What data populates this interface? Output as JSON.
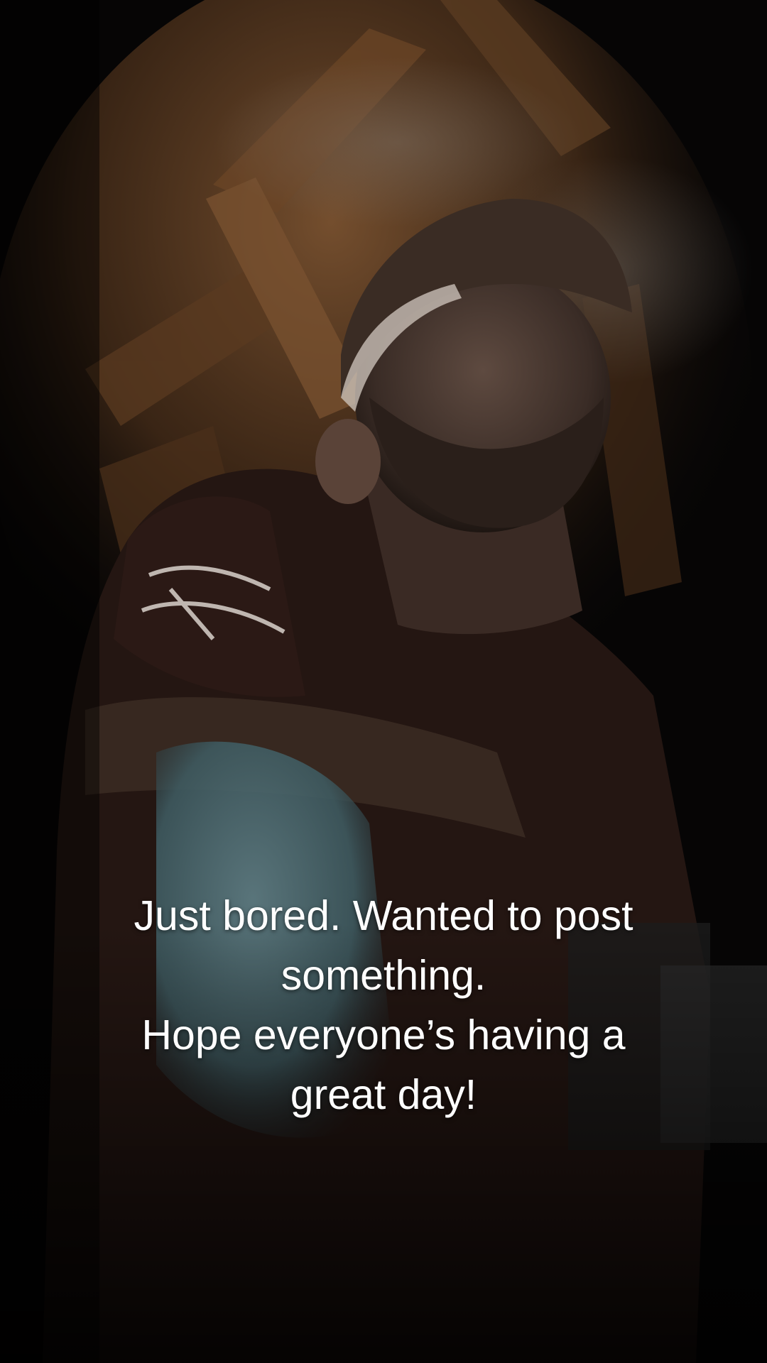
{
  "caption": {
    "lines": [
      "Just bored. Wanted to post",
      "something.",
      "Hope everyone’s having a",
      "great day!"
    ]
  },
  "colors": {
    "background": "#060505",
    "wood": "#6b4526",
    "shirt": "#241612",
    "cap": "#3a2c24",
    "denim": "#3e5a60",
    "text": "#ffffff"
  }
}
